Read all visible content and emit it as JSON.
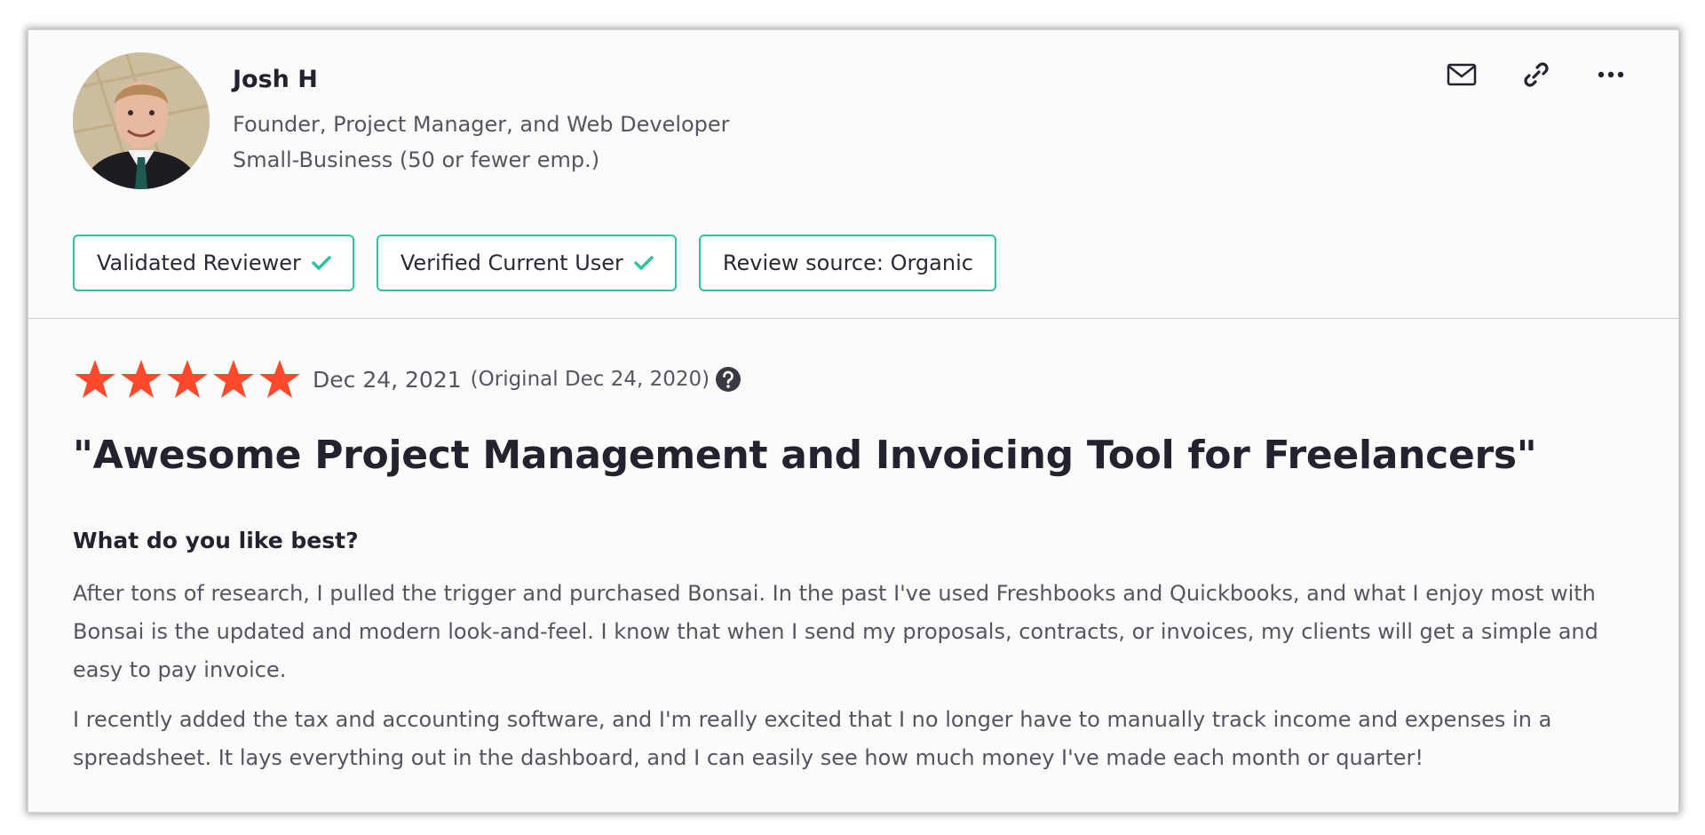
{
  "reviewer": {
    "name": "Josh H",
    "role": "Founder, Project Manager, and Web Developer",
    "company_size": "Small-Business (50 or fewer emp.)"
  },
  "actions": {
    "icons": [
      "mail-icon",
      "link-icon",
      "more-icon"
    ]
  },
  "badges": [
    {
      "label": "Validated Reviewer",
      "icon": "check-icon"
    },
    {
      "label": "Verified Current User",
      "icon": "check-icon"
    },
    {
      "label": "Review source: Organic"
    }
  ],
  "review": {
    "rating": 5,
    "rating_max": 5,
    "date": "Dec 24, 2021",
    "original_date": "(Original Dec 24, 2020)",
    "title": "\"Awesome Project Management and Invoicing Tool for Freelancers\"",
    "question": "What do you like best?",
    "paragraphs": [
      "After tons of research, I pulled the trigger and purchased Bonsai. In the past I've used Freshbooks and Quickbooks, and what I enjoy most with Bonsai is the updated and modern look-and-feel. I know that when I send my proposals, contracts, or invoices, my clients will get a simple and easy to pay invoice.",
      "I recently added the tax and accounting software, and I'm really excited that I no longer have to manually track income and expenses in a spreadsheet. It lays everything out in the dashboard, and I can easily see how much money I've made each month or quarter!"
    ]
  },
  "colors": {
    "accent_green": "#2ec4a0",
    "star_orange": "#ff492c",
    "text_dark": "#23222e",
    "text_muted": "#56555f"
  }
}
